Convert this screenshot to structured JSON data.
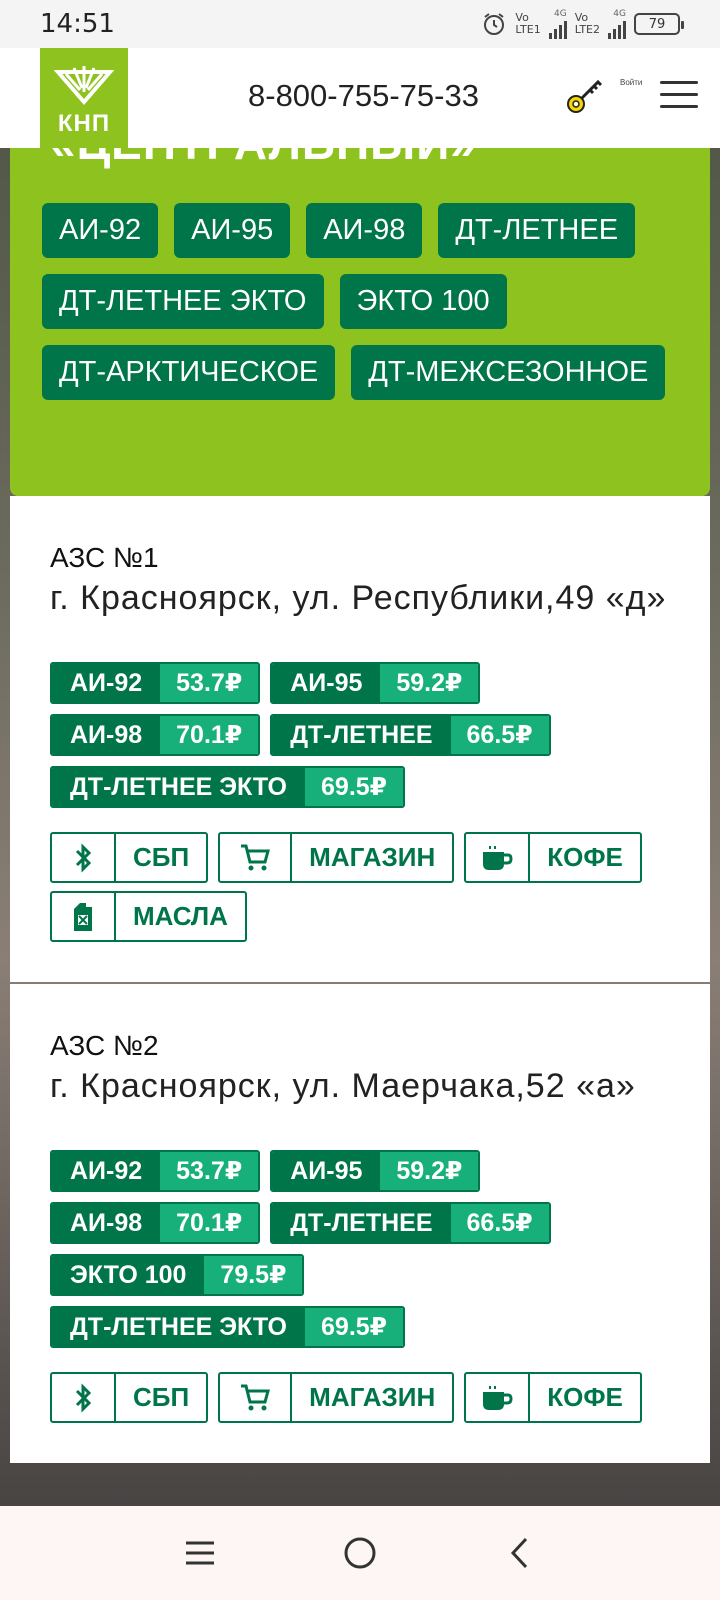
{
  "status_bar": {
    "time": "14:51",
    "sim1": {
      "top": "Vo",
      "bottom": "LTE1",
      "net": "4G"
    },
    "sim2": {
      "top": "Vo",
      "bottom": "LTE2",
      "net": "4G"
    },
    "battery": "79"
  },
  "header": {
    "logo_text": "КНП",
    "phone": "8-800-755-75-33",
    "login_label": "Войти"
  },
  "panel": {
    "title": "«ЦЕНТРАЛЬНЫЙ»",
    "fuels": [
      "АИ-92",
      "АИ-95",
      "АИ-98",
      "ДТ-ЛЕТНЕЕ",
      "ДТ-ЛЕТНЕЕ ЭКТО",
      "ЭКТО 100",
      "ДТ-АРКТИЧЕСКОЕ",
      "ДТ-МЕЖСЕЗОННОЕ"
    ]
  },
  "stations": [
    {
      "number": "АЗС №1",
      "address": "г. Красноярск, ул. Республики,49 «д»",
      "prices": [
        {
          "fuel": "АИ-92",
          "price": "53.7₽"
        },
        {
          "fuel": "АИ-95",
          "price": "59.2₽"
        },
        {
          "fuel": "АИ-98",
          "price": "70.1₽"
        },
        {
          "fuel": "ДТ-ЛЕТНЕЕ",
          "price": "66.5₽"
        },
        {
          "fuel": "ДТ-ЛЕТНЕЕ ЭКТО",
          "price": "69.5₽"
        }
      ],
      "services": [
        {
          "icon": "bluetooth-icon",
          "label": "СБП"
        },
        {
          "icon": "cart-icon",
          "label": "МАГАЗИН"
        },
        {
          "icon": "coffee-cup-icon",
          "label": "КОФЕ"
        },
        {
          "icon": "oil-canister-icon",
          "label": "МАСЛА"
        }
      ]
    },
    {
      "number": "АЗС №2",
      "address": "г. Красноярск, ул. Маерчака,52 «а»",
      "prices": [
        {
          "fuel": "АИ-92",
          "price": "53.7₽"
        },
        {
          "fuel": "АИ-95",
          "price": "59.2₽"
        },
        {
          "fuel": "АИ-98",
          "price": "70.1₽"
        },
        {
          "fuel": "ДТ-ЛЕТНЕЕ",
          "price": "66.5₽"
        },
        {
          "fuel": "ЭКТО 100",
          "price": "79.5₽"
        },
        {
          "fuel": "ДТ-ЛЕТНЕЕ ЭКТО",
          "price": "69.5₽"
        }
      ],
      "services": [
        {
          "icon": "bluetooth-icon",
          "label": "СБП"
        },
        {
          "icon": "cart-icon",
          "label": "МАГАЗИН"
        },
        {
          "icon": "coffee-cup-icon",
          "label": "КОФЕ"
        }
      ]
    }
  ],
  "colors": {
    "brand_green": "#8dc21f",
    "dark_green": "#00754a",
    "price_green": "#17b07a"
  }
}
